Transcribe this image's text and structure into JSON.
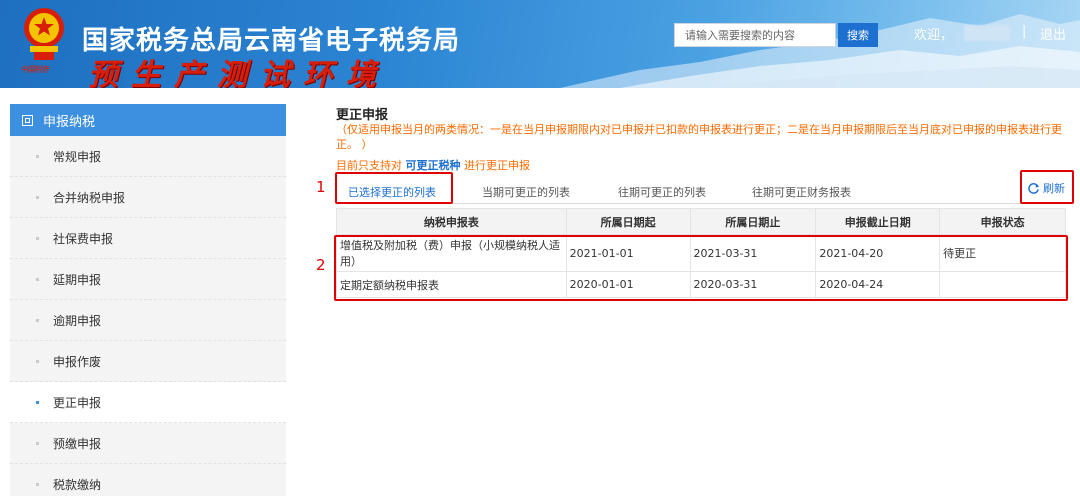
{
  "header": {
    "title": "国家税务总局云南省电子税务局",
    "subtitle": "预生产测试环境",
    "emblem_caption": "中国税务",
    "search_placeholder": "请输入需要搜索的内容",
    "search_button": "搜索",
    "welcome": "欢迎，",
    "separator": "|",
    "logout": "退出"
  },
  "sidebar": {
    "header": "申报纳税",
    "items": [
      "常规申报",
      "合并纳税申报",
      "社保费申报",
      "延期申报",
      "逾期申报",
      "申报作废",
      "更正申报",
      "预缴申报",
      "税款缴纳"
    ],
    "active_index": 6
  },
  "main": {
    "title": "更正申报",
    "notice": "（仅适用申报当月的两类情况：一是在当月申报期限内对已申报并已扣款的申报表进行更正；二是在当月申报期限后至当月底对已申报的申报表进行更正。 ）",
    "support_prefix": "目前只支持对",
    "support_link": "可更正税种",
    "support_suffix": "进行更正申报",
    "tabs": [
      "已选择更正的列表",
      "当期可更正的列表",
      "往期可更正的列表",
      "往期可更正财务报表"
    ],
    "refresh": "刷新",
    "markers": [
      "1",
      "2"
    ],
    "table": {
      "headers": [
        "纳税申报表",
        "所属日期起",
        "所属日期止",
        "申报截止日期",
        "申报状态"
      ],
      "rows": [
        [
          "增值税及附加税（费）申报（小规模纳税人适用）",
          "2021-01-01",
          "2021-03-31",
          "2021-04-20",
          "待更正"
        ],
        [
          "定期定额纳税申报表",
          "2020-01-01",
          "2020-03-31",
          "2020-04-24",
          ""
        ]
      ]
    }
  },
  "colors": {
    "header_blue": "#2b84d2",
    "sidebar_blue": "#3d8fe0",
    "notice_orange": "#ff6a00",
    "link_blue": "#1d6fd0",
    "annotation_red": "#e00000"
  }
}
